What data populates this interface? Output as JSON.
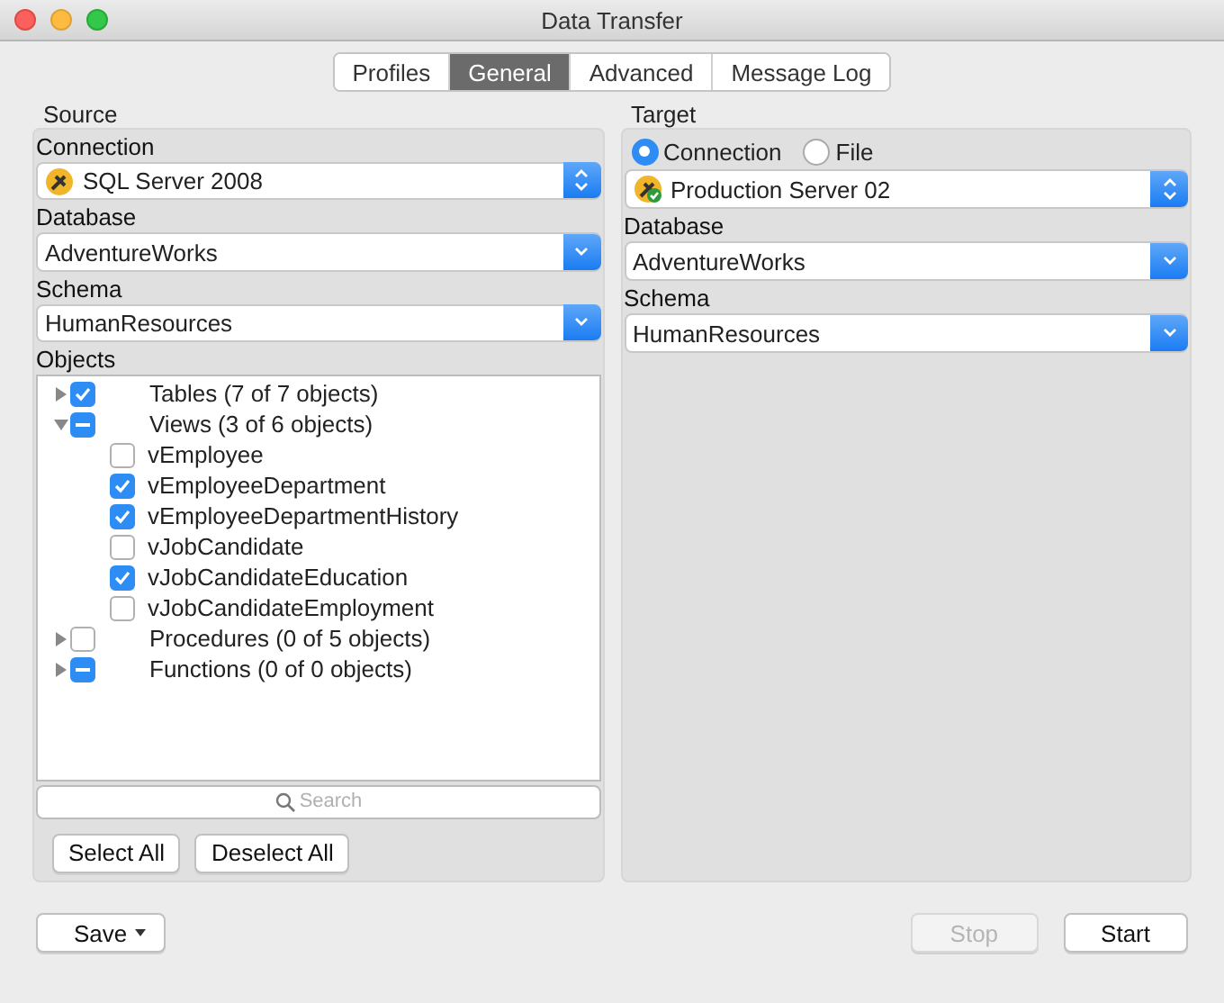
{
  "window": {
    "title": "Data Transfer"
  },
  "tabs": [
    {
      "label": "Profiles",
      "selected": false
    },
    {
      "label": "General",
      "selected": true
    },
    {
      "label": "Advanced",
      "selected": false
    },
    {
      "label": "Message Log",
      "selected": false
    }
  ],
  "source": {
    "title": "Source",
    "connection_label": "Connection",
    "connection": {
      "value": "SQL Server 2008",
      "kind": "popup",
      "connected": false
    },
    "database_label": "Database",
    "database": {
      "value": "AdventureWorks",
      "kind": "combo"
    },
    "schema_label": "Schema",
    "schema": {
      "value": "HumanResources",
      "kind": "combo"
    },
    "objects_label": "Objects",
    "objects": [
      {
        "label": "Tables (7 of 7 objects)",
        "checked": true,
        "partial": false,
        "expanded": false
      },
      {
        "label": "Views (3 of 6 objects)",
        "checked": true,
        "partial": true,
        "expanded": true,
        "children": [
          {
            "label": "vEmployee",
            "checked": false
          },
          {
            "label": "vEmployeeDepartment",
            "checked": true
          },
          {
            "label": "vEmployeeDepartmentHistory",
            "checked": true
          },
          {
            "label": "vJobCandidate",
            "checked": false
          },
          {
            "label": "vJobCandidateEducation",
            "checked": true
          },
          {
            "label": "vJobCandidateEmployment",
            "checked": false
          }
        ]
      },
      {
        "label": "Procedures (0 of 5 objects)",
        "checked": false,
        "partial": false,
        "expanded": false
      },
      {
        "label": "Functions (0 of 0 objects)",
        "checked": true,
        "partial": true,
        "expanded": false
      }
    ],
    "search": {
      "placeholder": "Search"
    },
    "buttons": [
      "Select All",
      "Deselect All"
    ]
  },
  "target": {
    "title": "Target",
    "modes": [
      {
        "label": "Connection",
        "selected": true
      },
      {
        "label": "File",
        "selected": false
      }
    ],
    "connection": {
      "value": "Production Server 02",
      "kind": "popup",
      "connected": true
    },
    "database_label": "Database",
    "database": {
      "value": "AdventureWorks",
      "kind": "combo"
    },
    "schema_label": "Schema",
    "schema": {
      "value": "HumanResources",
      "kind": "combo"
    }
  },
  "footer": {
    "save": "Save",
    "stop": {
      "label": "Stop",
      "disabled": true
    },
    "start": {
      "label": "Start",
      "disabled": false
    }
  }
}
